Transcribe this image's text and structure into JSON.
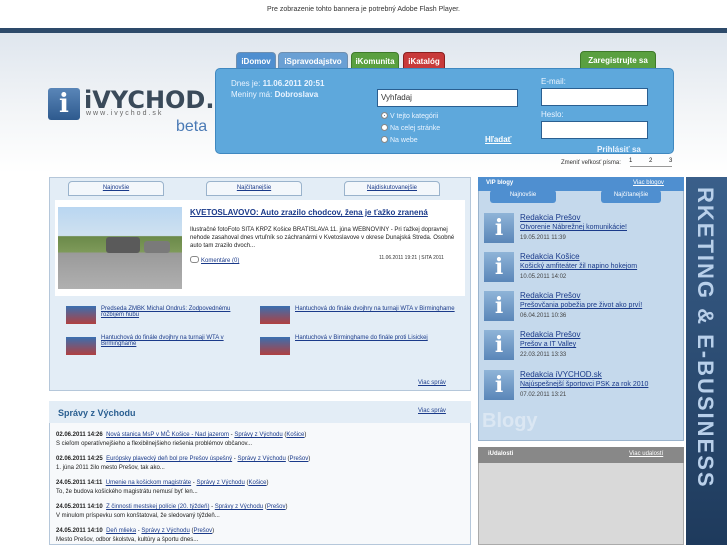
{
  "banner": {
    "notice": "Pre zobrazenie tohto bannera je potrebný Adobe Flash Player."
  },
  "tabs": [
    {
      "label": "iDomov",
      "color": "#4f8fd0"
    },
    {
      "label": "iSpravodajstvo",
      "color": "#6aa0d4"
    },
    {
      "label": "iKomunita",
      "color": "#5aa040"
    },
    {
      "label": "iKatalóg",
      "color": "#c83a3a"
    }
  ],
  "register_button": "Zaregistrujte sa",
  "logo": {
    "name": "iVYCHOD.sk",
    "url": "www.ivychod.sk",
    "beta": "beta"
  },
  "panel": {
    "date_label": "Dnes je:",
    "date_value": "11.06.2011 20:51",
    "name_day_label": "Meniny má:",
    "name_day_value": "Dobroslava",
    "search_value": "Vyhľadaj",
    "radio_options": [
      "V tejto kategórii",
      "Na celej stránke",
      "Na webe"
    ],
    "search_button": "Hľadať",
    "email_label": "E-mail:",
    "password_label": "Heslo:",
    "login_button": "Prihlásiť sa"
  },
  "font_size": {
    "label": "Zmeniť veľkosť písma:",
    "options": [
      "1",
      "2",
      "3"
    ]
  },
  "news_tabs": [
    "Najnovšie",
    "Najčítanejšie",
    "Najdiskutovanejšie"
  ],
  "feature": {
    "title": "KVETOSLAVOVO: Auto zrazilo chodcov, žena je ťažko zranená",
    "text": "Ilustračné fotoFoto SITA KRPZ Košice BRATISLAVA 11. júna WEBNOVINY - Pri ťažkej dopravnej nehode zasahoval dnes vrtuľník so záchranármi v Kvetoslavove v okrese Dunajská Streda. Osobné auto tam zrazilo dvoch...",
    "meta": "11.06.2011 19:21 | SITA 2011",
    "comments": "Komentáre (0)"
  },
  "sub_news": [
    "Predseda ZMBK Michal Ondruš: Zodpovednému rozbíjem hubu",
    "Hantuchová do finále dvojhry na turnaji WTA v Birminghame",
    "Hantuchová do finále dvojhry na turnaji WTA v Birminghame",
    "Hantuchová v Birminghame do finále proti Lisickej"
  ],
  "more_news": "Viac správ",
  "east_news": {
    "title": "Správy z Východu",
    "more": "Viac správ",
    "items": [
      {
        "date": "02.06.2011 14:26",
        "title": "Nová stanica MsP v MČ Košice - Nad jazerom",
        "section": "Správy z Východu",
        "city": "Košice",
        "text": "S cieľom operatívnejšieho a flexibilnejšieho riešenia problémov občanov..."
      },
      {
        "date": "02.06.2011 14:25",
        "title": "Európsky plavecký deň bol pre Prešov úspešný",
        "section": "Správy z Východu",
        "city": "Prešov",
        "text": "1. júna 2011 žilo mesto Prešov, tak ako..."
      },
      {
        "date": "24.05.2011 14:11",
        "title": "Umenie na košickom magistráte",
        "section": "Správy z Východu",
        "city": "Košice",
        "text": "To, že budova košického magistrátu nemusí byť len..."
      },
      {
        "date": "24.05.2011 14:10",
        "title": "Z činnosti mestskej polície (20. týždeň)",
        "section": "Správy z Východu",
        "city": "Prešov",
        "text": "V minulom príspevku som konštatoval, že sledovaný týždeň..."
      },
      {
        "date": "24.05.2011 14:10",
        "title": "Deň mlieka",
        "section": "Správy z Východu",
        "city": "Prešov",
        "text": "Mesto Prešov, odbor školstva, kultúry a športu dnes..."
      }
    ]
  },
  "vip": {
    "title": "VIP blogy",
    "more": "Viac blogov",
    "tabs": [
      "Najnovšie",
      "Najčítanejšie"
    ],
    "watermark": "Blogy",
    "items": [
      {
        "name": "Redakcia Prešov",
        "desc": "Otvorenie Nábrežnej komunikácie!",
        "date": "19.05.2011 11:39"
      },
      {
        "name": "Redakcia Košice",
        "desc": "Košický amfiteáter žil napino hokejom",
        "date": "10.05.2011 14:02"
      },
      {
        "name": "Redakcia Prešov",
        "desc": "Prešovčania pobežia pre život ako prví!",
        "date": "06.04.2011 10:36"
      },
      {
        "name": "Redakcia Prešov",
        "desc": "Prešov a IT Valley",
        "date": "22.03.2011 13:33"
      },
      {
        "name": "Redakcia iVYCHOD.sk",
        "desc": "Najúspešnejší športovci PSK za rok 2010",
        "date": "07.02.2011 13:21"
      }
    ]
  },
  "events": {
    "title": "iUdalosti",
    "more": "Viac udalostí"
  },
  "right_ad": {
    "text": "RKETING & E-BUSINESS"
  }
}
